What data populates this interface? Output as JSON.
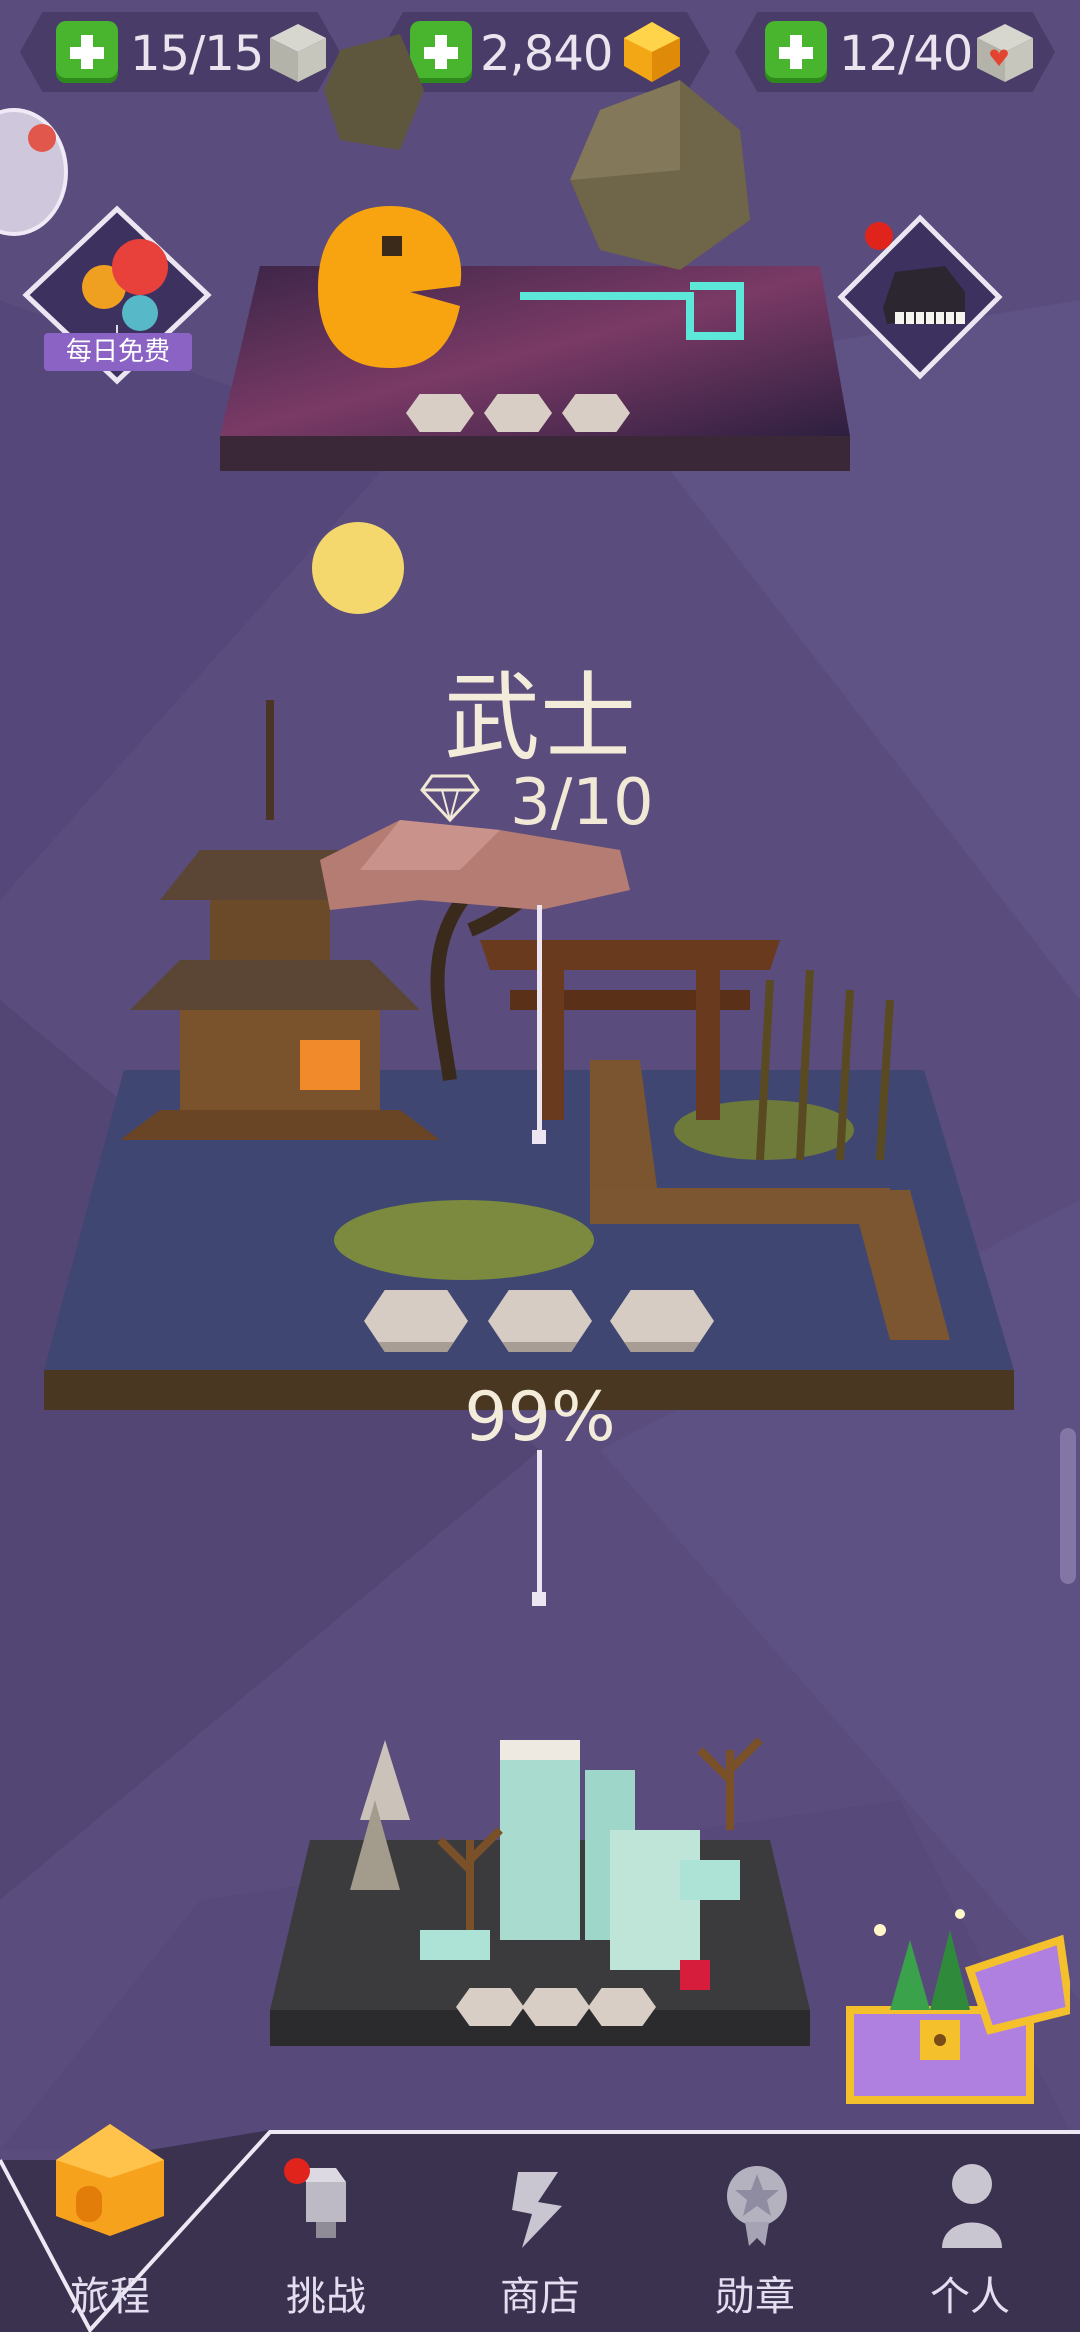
{
  "resources": {
    "cubes": {
      "value": "15/15",
      "icon": "grey-cube-icon"
    },
    "gems": {
      "value": "2,840",
      "icon": "gold-gem-icon"
    },
    "hearts": {
      "value": "12/40",
      "icon": "heart-cube-icon"
    }
  },
  "daily_free": {
    "label": "每日免费"
  },
  "level_current": {
    "title": "武士",
    "gems": "3/10",
    "progress": "99%",
    "progress_value": 0.99
  },
  "nav": {
    "items": [
      {
        "label": "旅程",
        "icon": "home-icon"
      },
      {
        "label": "挑战",
        "icon": "challenge-icon"
      },
      {
        "label": "商店",
        "icon": "shop-icon"
      },
      {
        "label": "勋章",
        "icon": "medal-icon"
      },
      {
        "label": "个人",
        "icon": "profile-icon"
      }
    ]
  },
  "colors": {
    "background": "#5a4c7d",
    "accent_green": "#49b52e",
    "gold": "#f6b21c",
    "notification": "#e0241c"
  }
}
